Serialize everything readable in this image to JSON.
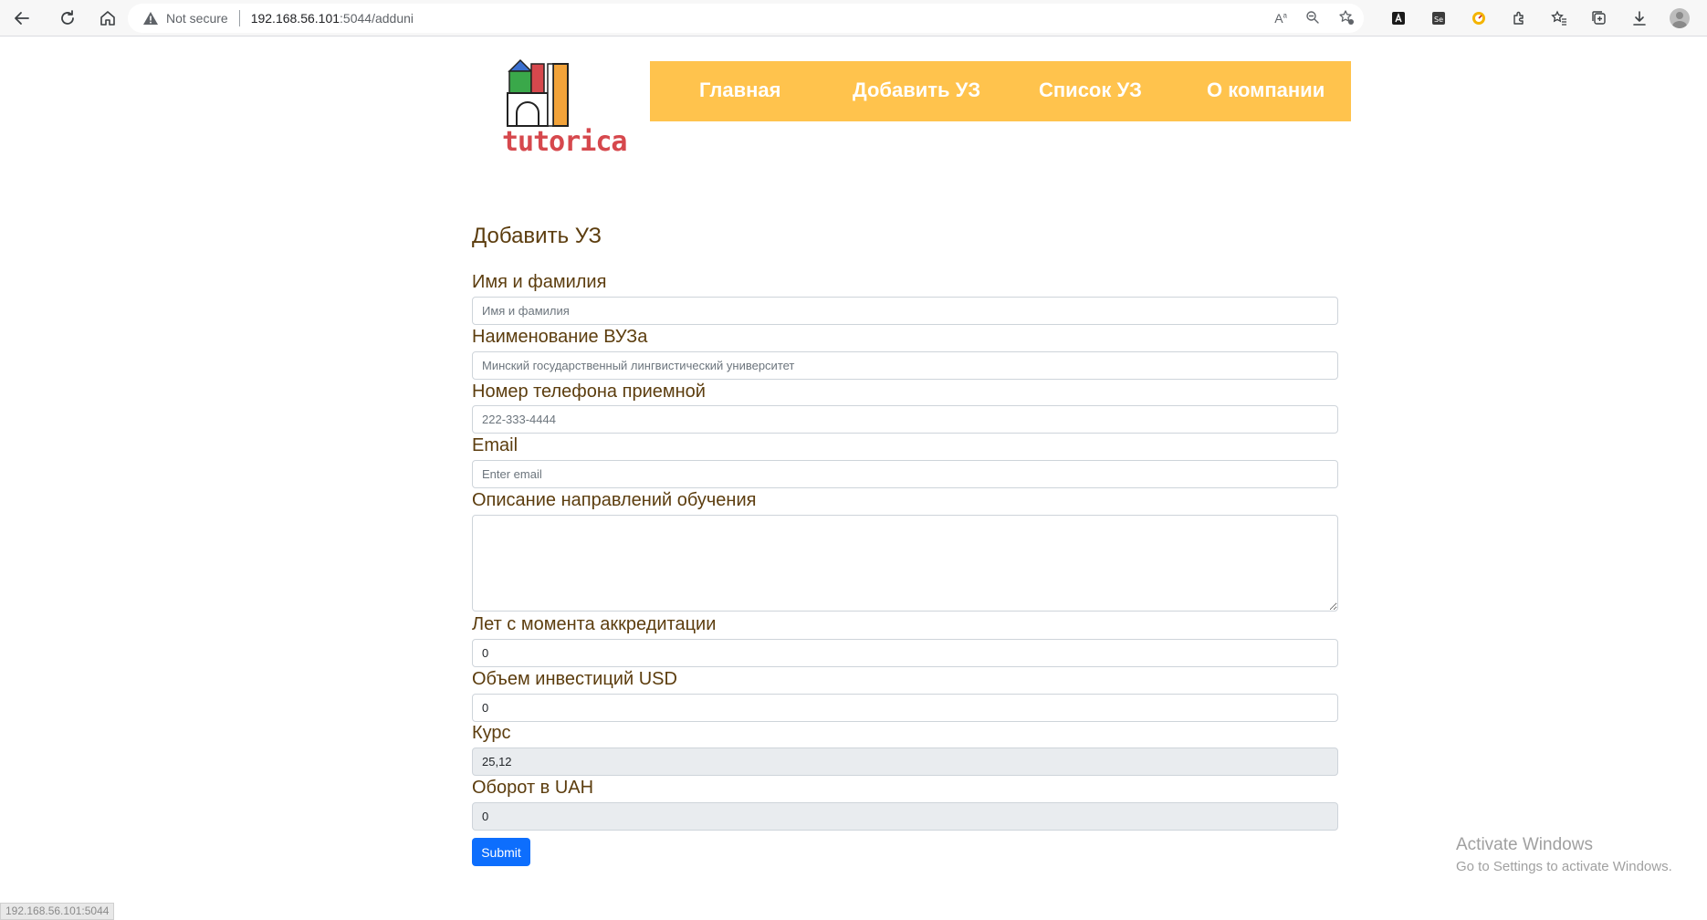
{
  "browser": {
    "not_secure": "Not secure",
    "url_host": "192.168.56.101",
    "url_rest": ":5044/adduni",
    "status_url": "192.168.56.101:5044"
  },
  "logo": {
    "text": "tutorica",
    "colors": {
      "green": "#3aa84a",
      "red": "#d6484d",
      "blue": "#3b6fcf",
      "orange": "#f2a33a"
    }
  },
  "nav": {
    "items": [
      {
        "label": "Главная"
      },
      {
        "label": "Добавить УЗ"
      },
      {
        "label": "Список УЗ"
      },
      {
        "label": "О компании"
      }
    ],
    "bg_color": "#ffc34d"
  },
  "form": {
    "title": "Добавить УЗ",
    "fields": {
      "name": {
        "label": "Имя и фамилия",
        "placeholder": "Имя и фамилия"
      },
      "university": {
        "label": "Наименование ВУЗа",
        "placeholder": "Минский государственный лингвистический университет"
      },
      "phone": {
        "label": "Номер телефона приемной",
        "placeholder": "222-333-4444"
      },
      "email": {
        "label": "Email",
        "placeholder": "Enter email"
      },
      "description": {
        "label": "Описание направлений обучения"
      },
      "years": {
        "label": "Лет с момента аккредитации",
        "value": "0"
      },
      "investment": {
        "label": "Объем инвестиций USD",
        "value": "0"
      },
      "rate": {
        "label": "Курс",
        "value": "25,12"
      },
      "turnover": {
        "label": "Оборот в UAH",
        "value": "0"
      }
    },
    "submit_label": "Submit"
  },
  "watermark": {
    "title": "Activate Windows",
    "subtitle": "Go to Settings to activate Windows."
  }
}
